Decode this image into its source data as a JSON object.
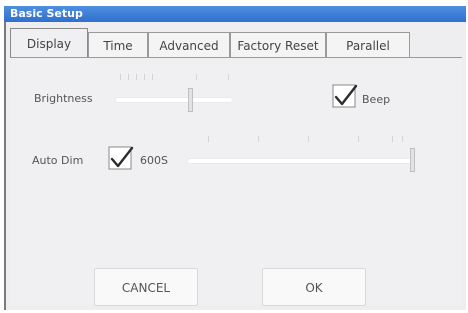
{
  "window": {
    "title": "Basic Setup"
  },
  "tabs": [
    {
      "label": "Display",
      "active": true
    },
    {
      "label": "Time",
      "active": false
    },
    {
      "label": "Advanced",
      "active": false
    },
    {
      "label": "Factory Reset",
      "active": false
    },
    {
      "label": "Parallel",
      "active": false
    }
  ],
  "display": {
    "brightness_label": "Brightness",
    "brightness_level": 0.6,
    "beep_label": "Beep",
    "beep_checked": true,
    "auto_dim_label": "Auto Dim",
    "auto_dim_checked": true,
    "auto_dim_value": "600S",
    "auto_dim_level": 1.0
  },
  "buttons": {
    "cancel": "CANCEL",
    "ok": "OK"
  },
  "colors": {
    "title_bar": "#2f6fd0",
    "panel_bg": "#f0f0f2"
  }
}
